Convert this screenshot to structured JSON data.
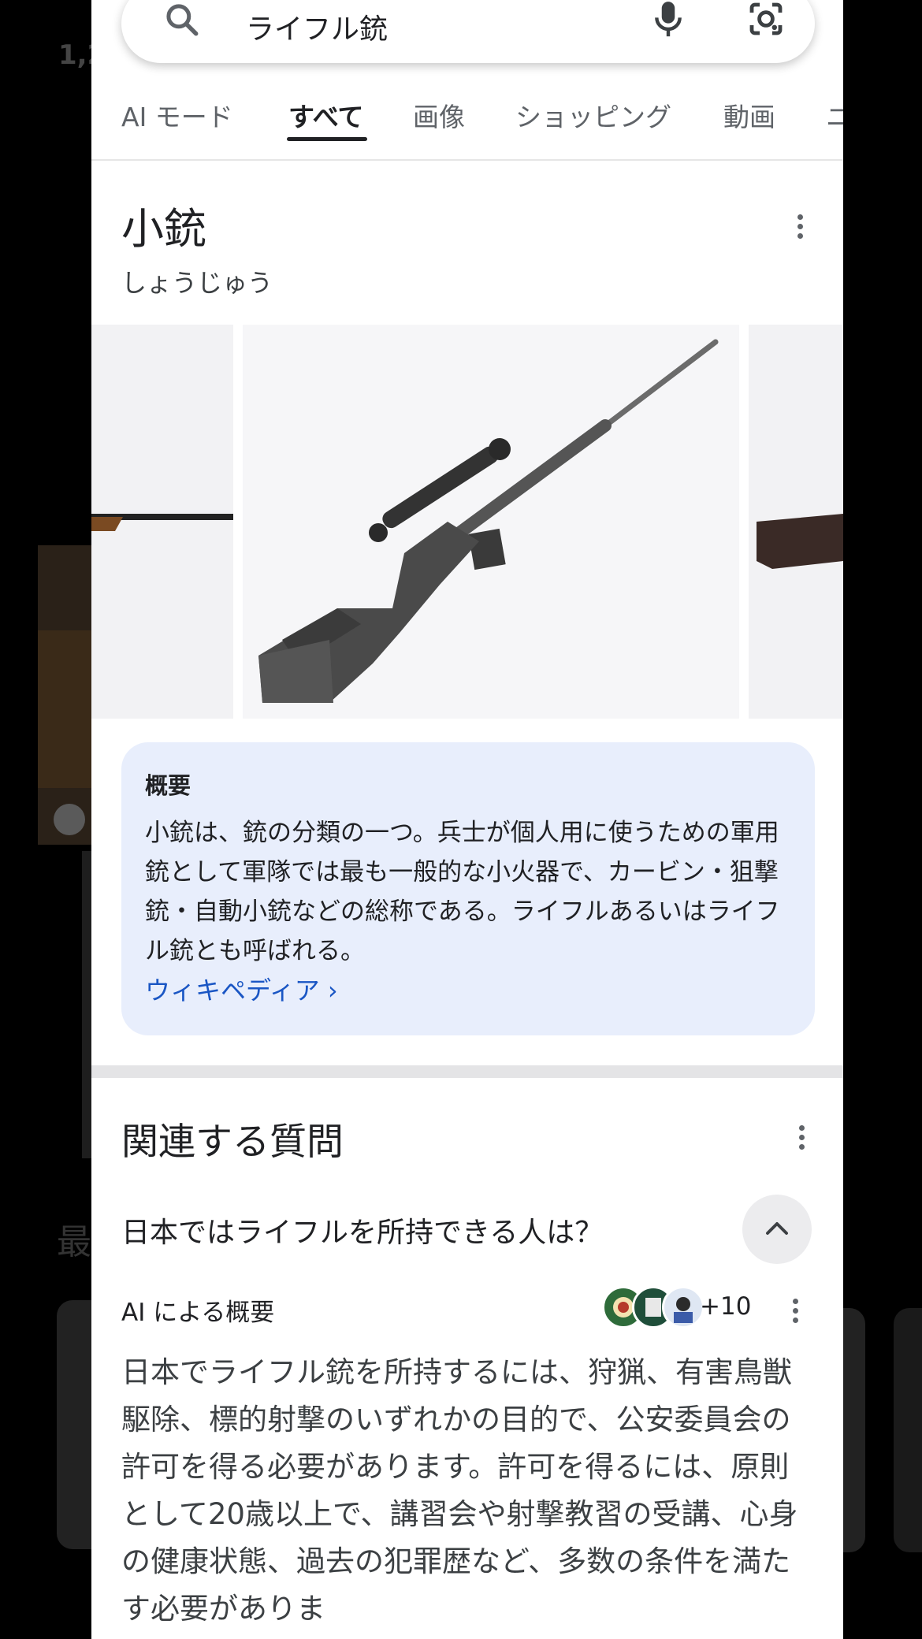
{
  "search": {
    "query": "ライフル銃"
  },
  "tabs": [
    {
      "label": "AI モード"
    },
    {
      "label": "すべて"
    },
    {
      "label": "画像"
    },
    {
      "label": "ショッピング"
    },
    {
      "label": "動画"
    },
    {
      "label": "ニ"
    }
  ],
  "knowledge_panel": {
    "title": "小銃",
    "reading": "しょうじゅう",
    "summary": {
      "label": "概要",
      "text": "小銃は、銃の分類の一つ。兵士が個人用に使うための軍用銃として軍隊では最も一般的な小火器で、カービン・狙撃銃・自動小銃などの総称である。ライフルあるいはライフル銃とも呼ばれる。",
      "source_link": "ウィキペディア ›"
    }
  },
  "related_questions": {
    "heading": "関連する質問",
    "question": "日本ではライフルを所持できる人は？",
    "ai_overview_label": "AI による概要",
    "sources_more": "+10",
    "answer": "日本でライフル銃を所持するには、狩猟、有害鳥獣駆除、標的射撃のいずれかの目的で、公安委員会の許可を得る必要があります。許可を得るには、原則として20歳以上で、講習会や射撃教習の受講、心身の健康状態、過去の犯罪歴など、多数の条件を満たす必要がありま"
  },
  "background": {
    "partial_text": "1,2",
    "partial_heading": "最"
  },
  "colors": {
    "accent_link": "#1a56c4",
    "summary_bg": "#e8eefc",
    "page_bg": "#000000"
  }
}
